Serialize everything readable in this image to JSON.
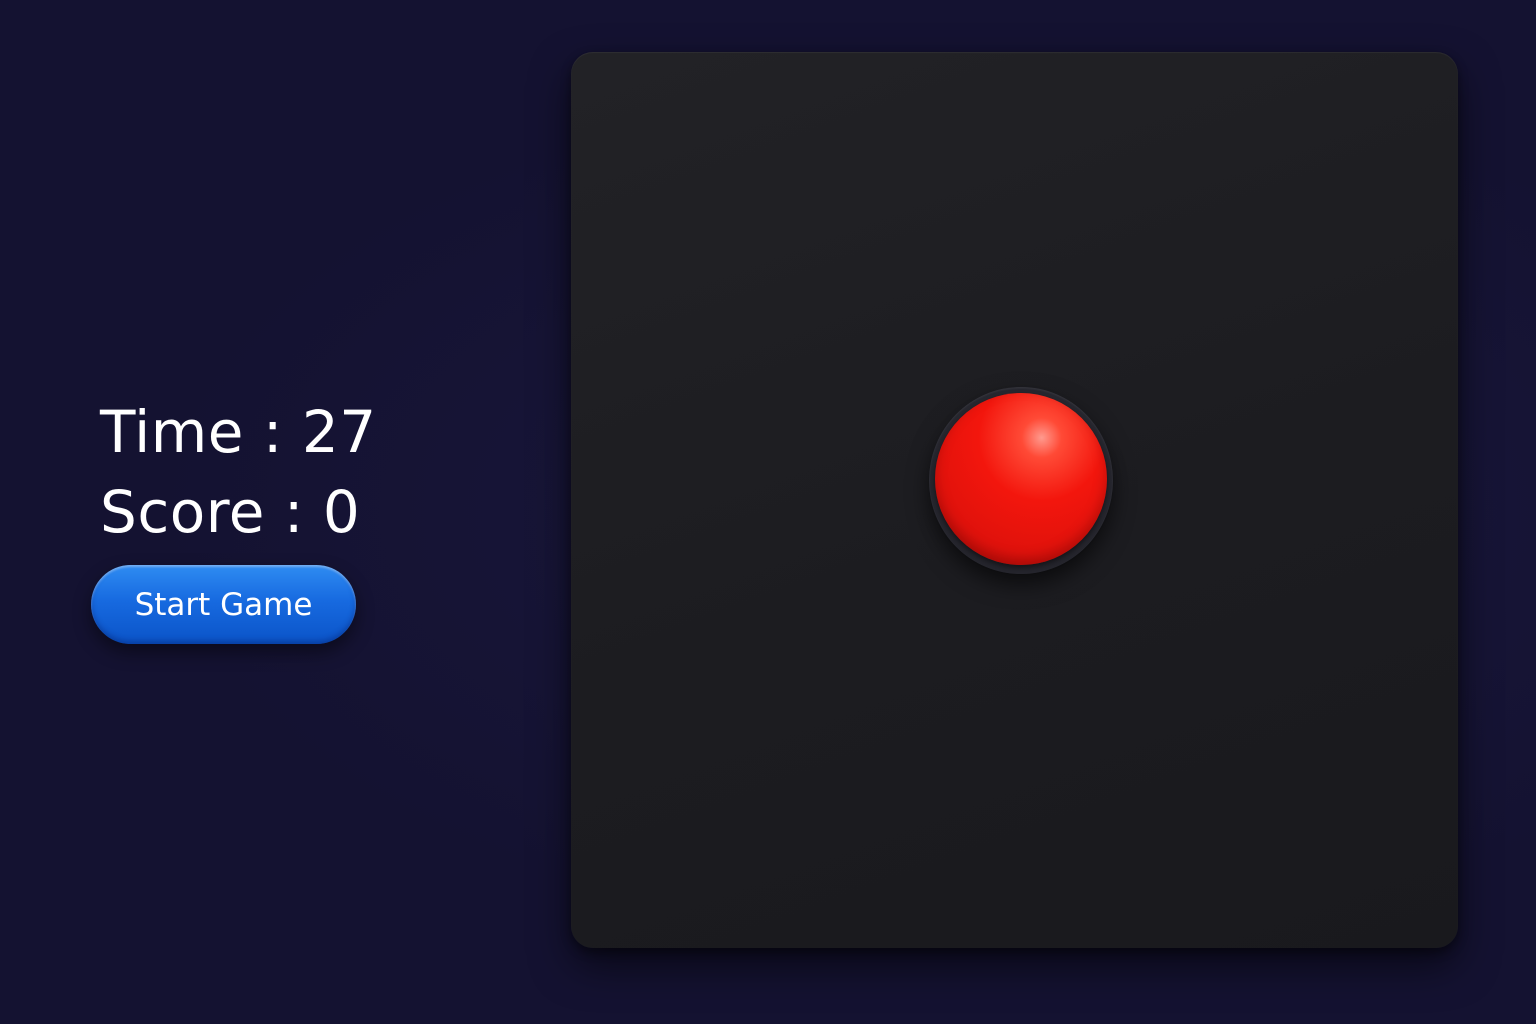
{
  "hud": {
    "time_label": "Time",
    "time_value": "27",
    "score_label": "Score",
    "score_value": "0",
    "separator": " : "
  },
  "controls": {
    "start_label": "Start Game"
  },
  "board": {
    "target": "red-button",
    "target_color": "#f3160d",
    "board_color": "#1e1e22",
    "background_color": "#141231",
    "accent_color": "#176ae0"
  }
}
